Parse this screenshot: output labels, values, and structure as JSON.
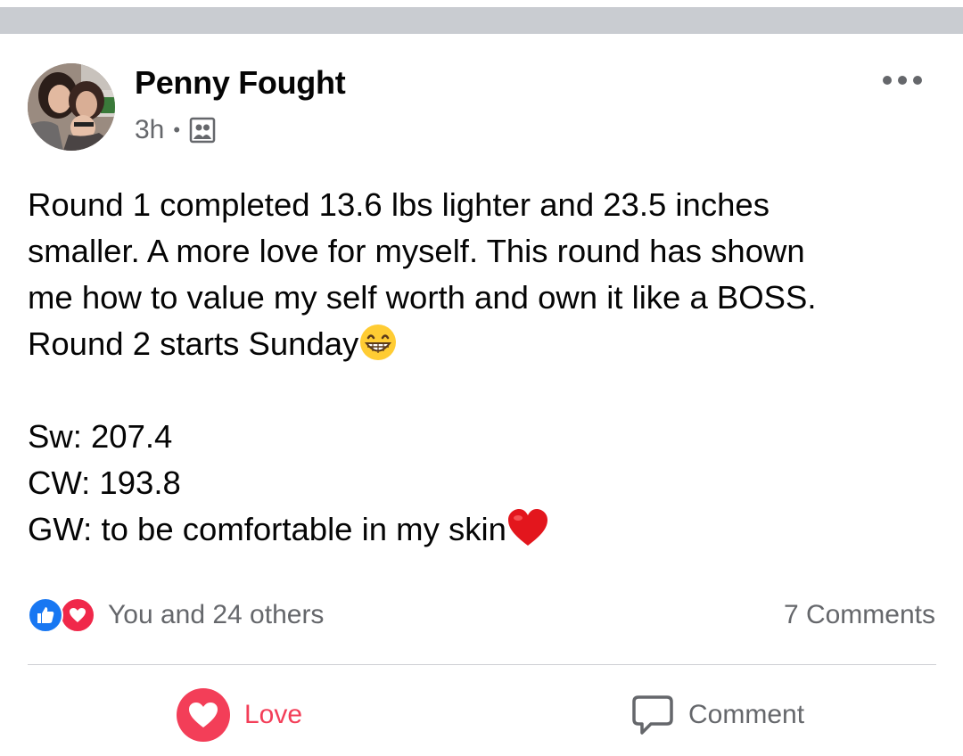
{
  "post": {
    "author": "Penny Fought",
    "time": "3h",
    "separator": "•",
    "audience_icon": "friends-icon",
    "more_icon": "more-options-icon",
    "lines": [
      "Round 1 completed 13.6 lbs lighter and 23.5 inches",
      "smaller.  A more love for myself. This round has shown",
      "me how to value my self worth and own it like a BOSS.",
      "Round 2 starts Sunday"
    ],
    "stats": [
      "Sw: 207.4",
      "CW: 193.8",
      "GW: to be comfortable in my skin"
    ]
  },
  "footer": {
    "reactions_text": "You and 24 others",
    "comments_text": "7 Comments",
    "love_label": "Love",
    "comment_label": "Comment"
  },
  "colors": {
    "love": "#f33e58",
    "like": "#1877f2",
    "secondary_text": "#65676b"
  }
}
